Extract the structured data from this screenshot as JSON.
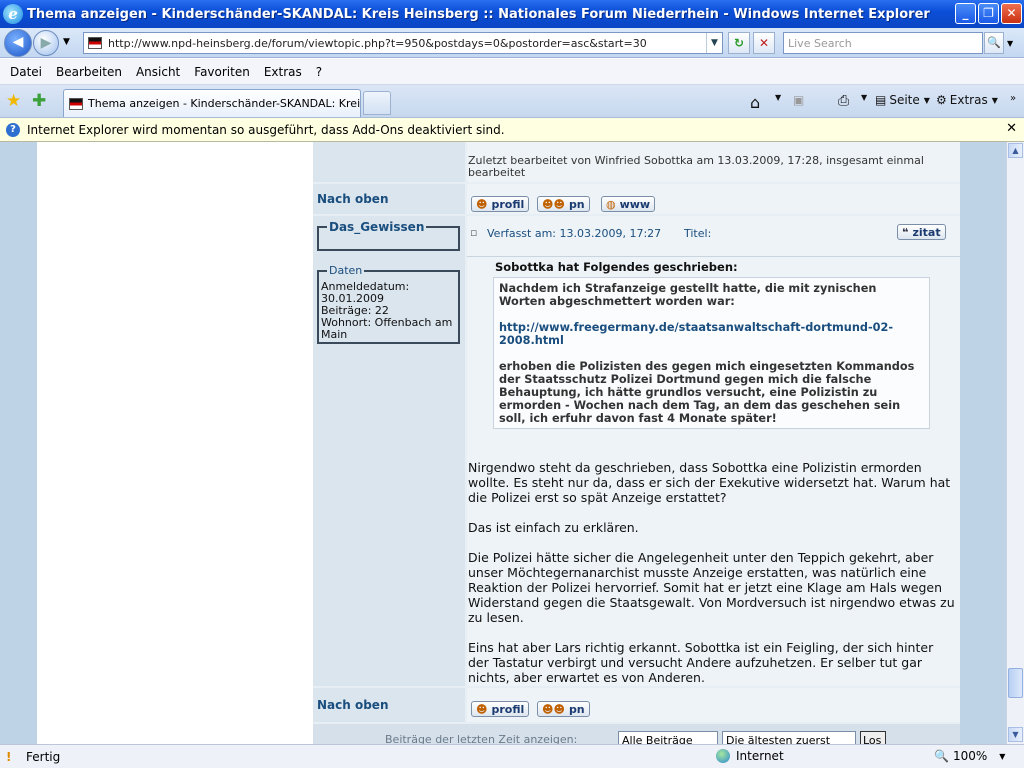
{
  "window": {
    "title": "Thema anzeigen - Kinderschänder-SKANDAL: Kreis Heinsberg :: Nationales Forum Niederrhein - Windows Internet Explorer",
    "minimize": "_",
    "maximize": "❐",
    "close": "✕"
  },
  "toolbar": {
    "url": "http://www.npd-heinsberg.de/forum/viewtopic.php?t=950&postdays=0&postorder=asc&start=30",
    "search_placeholder": "Live Search",
    "back": "◀",
    "forward": "▶",
    "refresh": "↻",
    "stop": "✕",
    "search_go": "🔍"
  },
  "menu": [
    "Datei",
    "Bearbeiten",
    "Ansicht",
    "Favoriten",
    "Extras",
    "?"
  ],
  "tab": {
    "label": "Thema anzeigen - Kinderschänder-SKANDAL: Kreis Hei...",
    "home": "Seite",
    "extras": "Extras"
  },
  "infobar": {
    "text": "Internet Explorer wird momentan so ausgeführt, dass Add-Ons deaktiviert sind.",
    "close": "✕"
  },
  "post1": {
    "edit_note": "Zuletzt bearbeitet von Winfried Sobottka am 13.03.2009, 17:28, insgesamt einmal bearbeitet",
    "back_to_top": "Nach oben",
    "buttons": [
      "profil",
      "pn",
      "www"
    ]
  },
  "post2": {
    "author": "Das_Gewissen",
    "data_legend": "Daten",
    "joined_label": "Anmeldedatum:",
    "joined": "30.01.2009",
    "posts": "Beiträge: 22",
    "location": "Wohnort: Offenbach am Main",
    "posted": "Verfasst am: 13.03.2009, 17:27",
    "title_label": "Titel:",
    "quote_button": "zitat",
    "quote_header": "Sobottka hat Folgendes geschrieben:",
    "quote_p1": "Nachdem ich Strafanzeige gestellt hatte, die mit zynischen Worten abgeschmettert worden war:",
    "quote_link": "http://www.freegermany.de/staatsanwaltschaft-dortmund-02-2008.html",
    "quote_p2": "erhoben die Polizisten des gegen mich eingesetzten Kommandos der Staatsschutz Polizei Dortmund gegen mich die falsche Behauptung, ich hätte grundlos versucht, eine Polizistin zu ermorden - Wochen nach dem Tag, an dem das geschehen sein soll, ich erfuhr davon fast 4 Monate später!",
    "body_p1": "Nirgendwo steht da geschrieben, dass Sobottka eine Polizistin ermorden wollte. Es steht nur da, dass er sich der Exekutive widersetzt hat. Warum hat die Polizei erst so spät Anzeige erstattet?",
    "body_p2": "Das ist einfach zu erklären.",
    "body_p3": "Die Polizei hätte sicher die Angelegenheit unter den Teppich gekehrt, aber unser Möchtegernanarchist musste Anzeige erstatten, was natürlich eine Reaktion der Polizei hervorrief. Somit hat er jetzt eine Klage am Hals wegen Widerstand gegen die Staatsgewalt. Von Mordversuch ist nirgendwo etwas zu zu lesen.",
    "body_p4": "Eins hat aber Lars richtig erkannt. Sobottka ist ein Feigling, der sich hinter der Tastatur verbirgt und versucht Andere aufzuhetzen. Er selber tut gar nichts, aber erwartet es von Anderen.",
    "back_to_top": "Nach oben",
    "buttons": [
      "profil",
      "pn"
    ]
  },
  "footer": {
    "show_label": "Beiträge der letzten Zeit anzeigen:",
    "filter_value": "Alle Beiträge",
    "order_value": "Die ältesten zuerst",
    "go": "Los"
  },
  "status": {
    "text": "Fertig",
    "zone": "Internet",
    "zoom": "100%"
  }
}
